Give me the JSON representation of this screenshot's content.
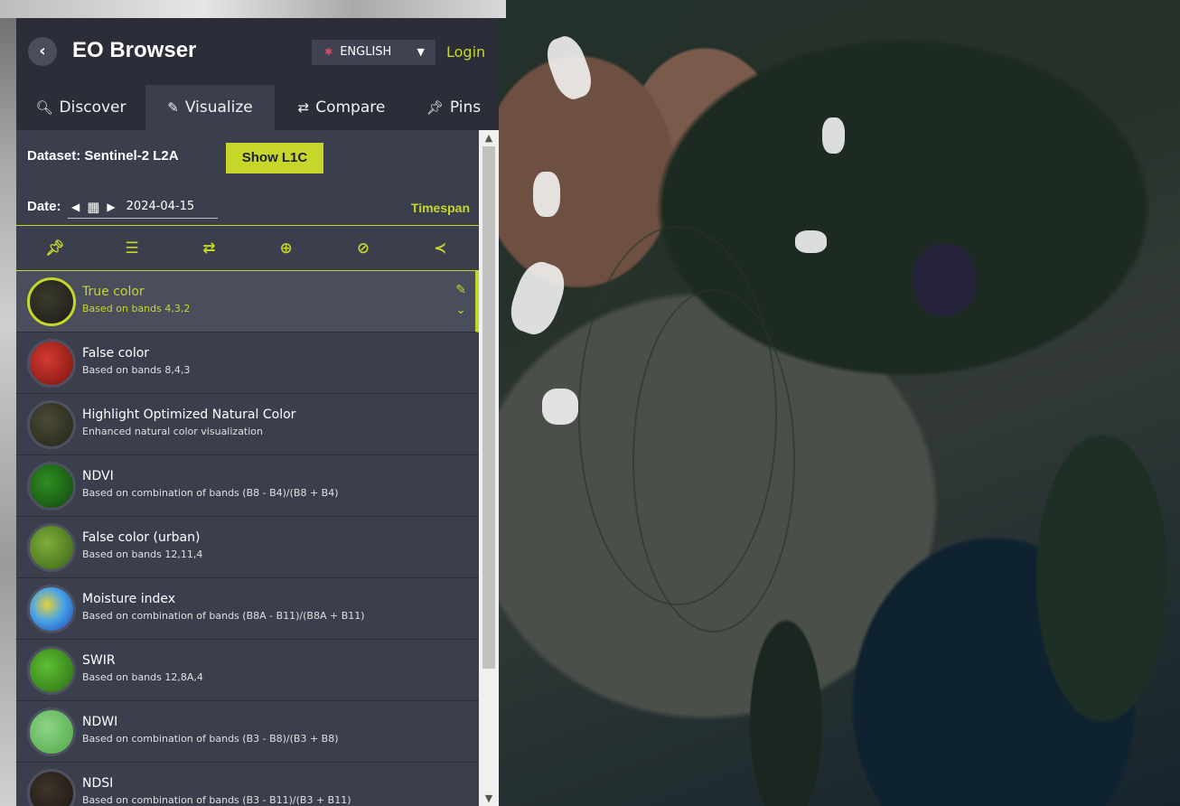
{
  "header": {
    "back_icon": "chevron-left-icon",
    "title": "EO Browser",
    "language": {
      "flag_icon": "uk-flag-icon",
      "value": "ENGLISH",
      "caret_icon": "caret-down-icon"
    },
    "login_label": "Login"
  },
  "tabs": [
    {
      "icon": "search-icon",
      "label": "Discover",
      "active": false
    },
    {
      "icon": "brush-icon",
      "label": "Visualize",
      "active": true
    },
    {
      "icon": "swap-icon",
      "label": "Compare",
      "active": false
    },
    {
      "icon": "pin-icon",
      "label": "Pins",
      "active": false
    }
  ],
  "dataset": {
    "label": "Dataset: Sentinel-2 L2A",
    "show_button": "Show L1C"
  },
  "date": {
    "label": "Date:",
    "value": "2024-04-15",
    "timespan_label": "Timespan"
  },
  "toolbar": [
    "pin-icon",
    "sliders-icon",
    "swap-icon",
    "crosshair-icon",
    "eye-slash-icon",
    "share-icon"
  ],
  "layers": [
    {
      "name": "True color",
      "desc": "Based on bands 4,3,2",
      "selected": true,
      "thumb_color": "#2a2820"
    },
    {
      "name": "False color",
      "desc": "Based on bands 8,4,3",
      "selected": false,
      "thumb_color": "#a8201c"
    },
    {
      "name": "Highlight Optimized Natural Color",
      "desc": "Enhanced natural color visualization",
      "selected": false,
      "thumb_color": "#3a3a28"
    },
    {
      "name": "NDVI",
      "desc": "Based on combination of bands (B8 - B4)/(B8 + B4)",
      "selected": false,
      "thumb_color": "#1f6b1a"
    },
    {
      "name": "False color (urban)",
      "desc": "Based on bands 12,11,4",
      "selected": false,
      "thumb_color": "#5a8a24"
    },
    {
      "name": "Moisture index",
      "desc": "Based on combination of bands (B8A - B11)/(B8A + B11)",
      "selected": false,
      "thumb_color": "#2f6ed0"
    },
    {
      "name": "SWIR",
      "desc": "Based on bands 12,8A,4",
      "selected": false,
      "thumb_color": "#3f8f25"
    },
    {
      "name": "NDWI",
      "desc": "Based on combination of bands (B3 - B8)/(B3 + B8)",
      "selected": false,
      "thumb_color": "#62b55e"
    },
    {
      "name": "NDSI",
      "desc": "Based on combination of bands (B3 - B11)/(B3 + B11)",
      "selected": false,
      "thumb_color": "#2c2620"
    }
  ],
  "colors": {
    "accent": "#c6d72a",
    "panel": "#3b3e4d",
    "header": "#2b2d39"
  }
}
